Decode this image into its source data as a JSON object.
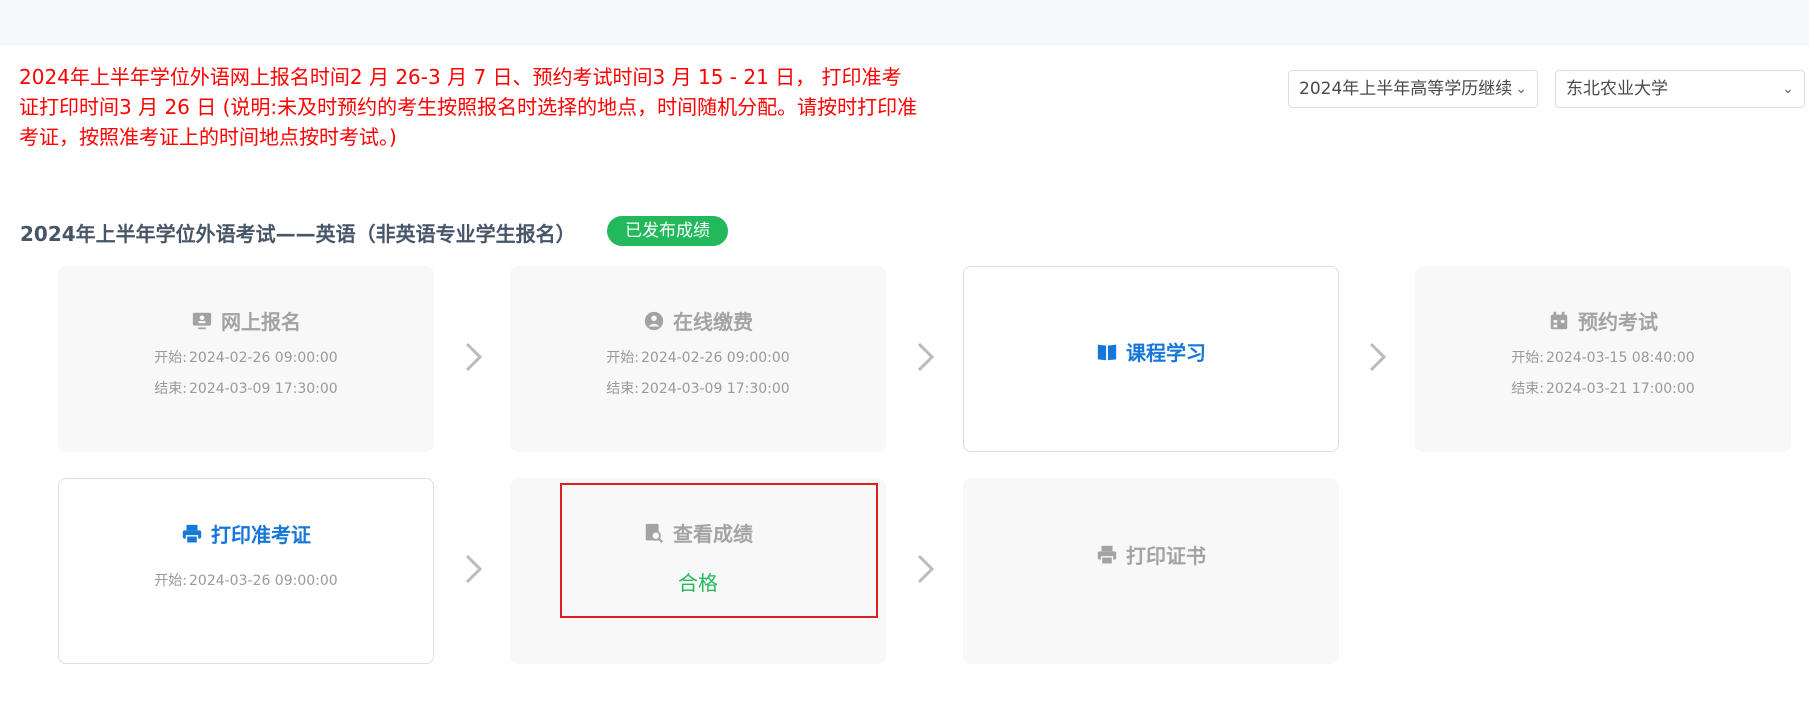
{
  "notice": "2024年上半年学位外语网上报名时间2 月 26-3 月 7 日、预约考试时间3 月 15 - 21 日， 打印准考证打印时间3 月 26 日 (说明:未及时预约的考生按照报名时选择的地点，时间随机分配。请按时打印准考证，按照准考证上的时间地点按时考试。)",
  "selects": {
    "term": "2024年上半年高等学历继续",
    "school": "东北农业大学"
  },
  "exam": {
    "title": "2024年上半年学位外语考试——英语（非英语专业学生报名）",
    "status": "已发布成绩"
  },
  "labels": {
    "start": "开始:",
    "end": "结束:"
  },
  "steps": [
    {
      "name": "网上报名",
      "icon": "monitor-icon",
      "start": "2024-02-26 09:00:00",
      "end": "2024-03-09 17:30:00",
      "active": false
    },
    {
      "name": "在线缴费",
      "icon": "payment-user-icon",
      "start": "2024-02-26 09:00:00",
      "end": "2024-03-09 17:30:00",
      "active": false
    },
    {
      "name": "课程学习",
      "icon": "book-icon",
      "active": true
    },
    {
      "name": "预约考试",
      "icon": "calendar-icon",
      "start": "2024-03-15 08:40:00",
      "end": "2024-03-21 17:00:00",
      "active": false
    },
    {
      "name": "打印准考证",
      "icon": "printer-icon",
      "start": "2024-03-26 09:00:00",
      "active": true
    },
    {
      "name": "查看成绩",
      "icon": "search-document-icon",
      "result": "合格",
      "active": false
    },
    {
      "name": "打印证书",
      "icon": "printer-icon",
      "active": false
    }
  ],
  "colors": {
    "accent": "#1677d8",
    "success": "#22b85b",
    "notice": "#ff0000",
    "highlight": "#e02020"
  }
}
